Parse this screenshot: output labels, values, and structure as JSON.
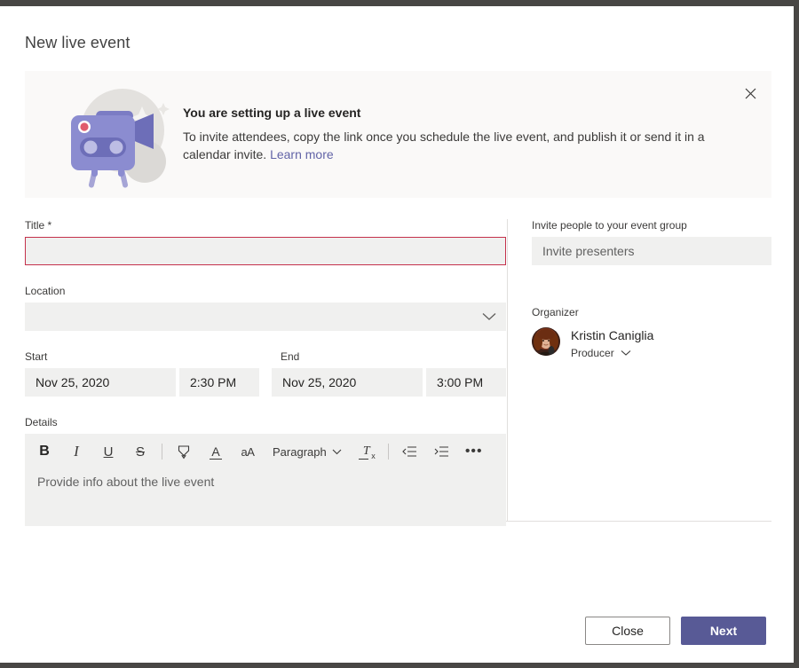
{
  "window": {
    "title": "New live event"
  },
  "banner": {
    "heading": "You are setting up a live event",
    "body_prefix": "To invite attendees, copy the link once you schedule the live event, and publish it or send it in a calendar invite. ",
    "link_label": "Learn more",
    "close_icon": "close-icon",
    "illustration_icon": "video-camera-tripod-illustration",
    "background": "#faf9f8"
  },
  "form": {
    "title": {
      "label": "Title *",
      "value": "",
      "placeholder": "",
      "required": true,
      "error_border_color": "#c4314b"
    },
    "location": {
      "label": "Location",
      "value": "",
      "placeholder": "",
      "chevron_icon": "chevron-down-icon"
    },
    "start": {
      "label": "Start",
      "date": "Nov 25, 2020",
      "time": "2:30 PM"
    },
    "end": {
      "label": "End",
      "date": "Nov 25, 2020",
      "time": "3:00 PM"
    },
    "details": {
      "label": "Details",
      "placeholder": "Provide info about the live event",
      "toolbar": [
        {
          "name": "bold-icon",
          "glyph": "B",
          "tooltip": "Bold"
        },
        {
          "name": "italic-icon",
          "glyph": "I",
          "tooltip": "Italic"
        },
        {
          "name": "underline-icon",
          "glyph": "U",
          "tooltip": "Underline"
        },
        {
          "name": "strikethrough-icon",
          "glyph": "S",
          "tooltip": "Strikethrough"
        },
        {
          "name": "divider",
          "glyph": "",
          "tooltip": ""
        },
        {
          "name": "highlight-icon",
          "glyph": "",
          "tooltip": "Highlight"
        },
        {
          "name": "font-color-icon",
          "glyph": "A",
          "tooltip": "Font color"
        },
        {
          "name": "font-size-icon",
          "glyph": "aA",
          "tooltip": "Font size"
        }
      ],
      "paragraph_label": "Paragraph",
      "paragraph_chevron_icon": "chevron-down-icon",
      "toolbar_end": [
        {
          "name": "clear-formatting-icon",
          "glyph": "Tx",
          "tooltip": "Clear formatting"
        },
        {
          "name": "divider",
          "glyph": "",
          "tooltip": ""
        },
        {
          "name": "decrease-indent-icon",
          "glyph": "",
          "tooltip": "Decrease indent"
        },
        {
          "name": "increase-indent-icon",
          "glyph": "",
          "tooltip": "Increase indent"
        },
        {
          "name": "more-options-icon",
          "glyph": "•••",
          "tooltip": "More options"
        }
      ]
    }
  },
  "right_panel": {
    "invite_label": "Invite people to your event group",
    "invite_placeholder": "Invite presenters",
    "organizer_label": "Organizer",
    "organizer": {
      "name": "Kristin Caniglia",
      "role": "Producer",
      "role_chevron_icon": "chevron-down-icon",
      "avatar_icon": "avatar"
    }
  },
  "footer": {
    "close_label": "Close",
    "next_label": "Next",
    "primary_color": "#585a96"
  }
}
